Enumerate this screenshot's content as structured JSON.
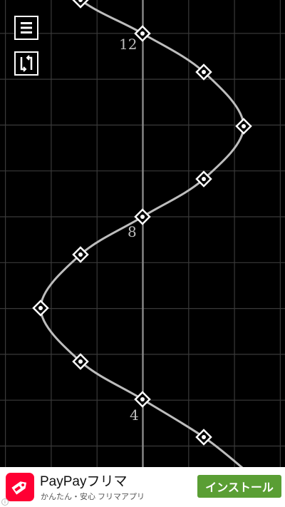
{
  "graph": {
    "background": "#000000",
    "grid_color": "#3a3a3a",
    "axis_color": "#8a8a8a",
    "curve_color": "#bdbdbd",
    "marker_color": "#ffffff",
    "axis_labels": {
      "y_12": "12",
      "y_8": "8",
      "y_4": "4"
    }
  },
  "toolbar": {
    "menu_icon": "hamburger-menu-icon",
    "swap_icon": "swap-axes-icon"
  },
  "ad": {
    "title": "PayPayフリマ",
    "subtitle": "かんたん・安心 フリマアプリ",
    "install_label": "インストール",
    "info_glyph": "i",
    "icon_color": "#ff0033",
    "button_color": "#5a9e34"
  }
}
